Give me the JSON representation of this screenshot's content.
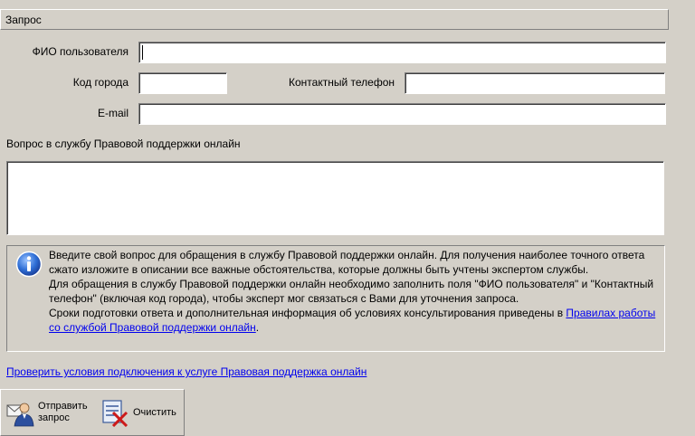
{
  "section": {
    "title": "Запрос"
  },
  "form": {
    "fio_label": "ФИО пользователя",
    "fio_value": "",
    "city_code_label": "Код города",
    "city_code_value": "",
    "phone_label": "Контактный телефон",
    "phone_value": "",
    "email_label": "E-mail",
    "email_value": "",
    "question_label": "Вопрос в службу Правовой поддержки онлайн",
    "question_value": ""
  },
  "info": {
    "line1": "Введите свой вопрос для обращения в службу Правовой поддержки онлайн. Для получения наиболее точного ответа сжато изложите в описании все важные обстоятельства, которые должны быть учтены экспертом службы.",
    "line2": "Для обращения в службу Правовой поддержки онлайн необходимо заполнить поля \"ФИО пользователя\" и \"Контактный телефон\" (включая код города), чтобы эксперт мог связаться с Вами для уточнения запроса.",
    "line3_prefix": "Сроки подготовки ответа и дополнительная информация об условиях консультирования приведены в ",
    "line3_link": "Правилах работы со службой Правовой поддержки онлайн",
    "line3_suffix": "."
  },
  "check_link": "Проверить условия подключения к услуге Правовая поддержка онлайн",
  "toolbar": {
    "send_label_1": "Отправить",
    "send_label_2": "запрос",
    "send_icon": "user-send-icon",
    "clear_label": "Очистить",
    "clear_icon": "clear-form-icon"
  }
}
